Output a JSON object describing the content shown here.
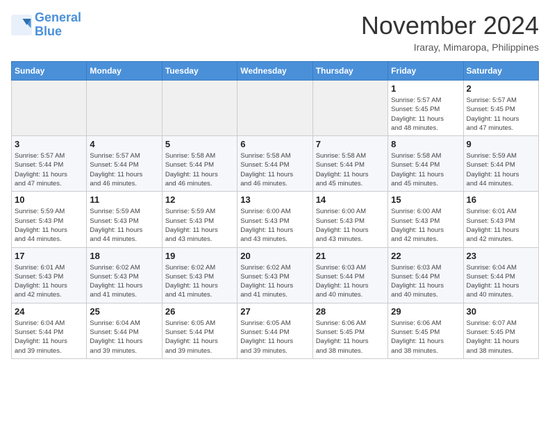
{
  "header": {
    "logo_line1": "General",
    "logo_line2": "Blue",
    "month_title": "November 2024",
    "location": "Iraray, Mimaropa, Philippines"
  },
  "days_of_week": [
    "Sunday",
    "Monday",
    "Tuesday",
    "Wednesday",
    "Thursday",
    "Friday",
    "Saturday"
  ],
  "weeks": [
    [
      {
        "day": "",
        "info": ""
      },
      {
        "day": "",
        "info": ""
      },
      {
        "day": "",
        "info": ""
      },
      {
        "day": "",
        "info": ""
      },
      {
        "day": "",
        "info": ""
      },
      {
        "day": "1",
        "info": "Sunrise: 5:57 AM\nSunset: 5:45 PM\nDaylight: 11 hours\nand 48 minutes."
      },
      {
        "day": "2",
        "info": "Sunrise: 5:57 AM\nSunset: 5:45 PM\nDaylight: 11 hours\nand 47 minutes."
      }
    ],
    [
      {
        "day": "3",
        "info": "Sunrise: 5:57 AM\nSunset: 5:44 PM\nDaylight: 11 hours\nand 47 minutes."
      },
      {
        "day": "4",
        "info": "Sunrise: 5:57 AM\nSunset: 5:44 PM\nDaylight: 11 hours\nand 46 minutes."
      },
      {
        "day": "5",
        "info": "Sunrise: 5:58 AM\nSunset: 5:44 PM\nDaylight: 11 hours\nand 46 minutes."
      },
      {
        "day": "6",
        "info": "Sunrise: 5:58 AM\nSunset: 5:44 PM\nDaylight: 11 hours\nand 46 minutes."
      },
      {
        "day": "7",
        "info": "Sunrise: 5:58 AM\nSunset: 5:44 PM\nDaylight: 11 hours\nand 45 minutes."
      },
      {
        "day": "8",
        "info": "Sunrise: 5:58 AM\nSunset: 5:44 PM\nDaylight: 11 hours\nand 45 minutes."
      },
      {
        "day": "9",
        "info": "Sunrise: 5:59 AM\nSunset: 5:44 PM\nDaylight: 11 hours\nand 44 minutes."
      }
    ],
    [
      {
        "day": "10",
        "info": "Sunrise: 5:59 AM\nSunset: 5:43 PM\nDaylight: 11 hours\nand 44 minutes."
      },
      {
        "day": "11",
        "info": "Sunrise: 5:59 AM\nSunset: 5:43 PM\nDaylight: 11 hours\nand 44 minutes."
      },
      {
        "day": "12",
        "info": "Sunrise: 5:59 AM\nSunset: 5:43 PM\nDaylight: 11 hours\nand 43 minutes."
      },
      {
        "day": "13",
        "info": "Sunrise: 6:00 AM\nSunset: 5:43 PM\nDaylight: 11 hours\nand 43 minutes."
      },
      {
        "day": "14",
        "info": "Sunrise: 6:00 AM\nSunset: 5:43 PM\nDaylight: 11 hours\nand 43 minutes."
      },
      {
        "day": "15",
        "info": "Sunrise: 6:00 AM\nSunset: 5:43 PM\nDaylight: 11 hours\nand 42 minutes."
      },
      {
        "day": "16",
        "info": "Sunrise: 6:01 AM\nSunset: 5:43 PM\nDaylight: 11 hours\nand 42 minutes."
      }
    ],
    [
      {
        "day": "17",
        "info": "Sunrise: 6:01 AM\nSunset: 5:43 PM\nDaylight: 11 hours\nand 42 minutes."
      },
      {
        "day": "18",
        "info": "Sunrise: 6:02 AM\nSunset: 5:43 PM\nDaylight: 11 hours\nand 41 minutes."
      },
      {
        "day": "19",
        "info": "Sunrise: 6:02 AM\nSunset: 5:43 PM\nDaylight: 11 hours\nand 41 minutes."
      },
      {
        "day": "20",
        "info": "Sunrise: 6:02 AM\nSunset: 5:43 PM\nDaylight: 11 hours\nand 41 minutes."
      },
      {
        "day": "21",
        "info": "Sunrise: 6:03 AM\nSunset: 5:44 PM\nDaylight: 11 hours\nand 40 minutes."
      },
      {
        "day": "22",
        "info": "Sunrise: 6:03 AM\nSunset: 5:44 PM\nDaylight: 11 hours\nand 40 minutes."
      },
      {
        "day": "23",
        "info": "Sunrise: 6:04 AM\nSunset: 5:44 PM\nDaylight: 11 hours\nand 40 minutes."
      }
    ],
    [
      {
        "day": "24",
        "info": "Sunrise: 6:04 AM\nSunset: 5:44 PM\nDaylight: 11 hours\nand 39 minutes."
      },
      {
        "day": "25",
        "info": "Sunrise: 6:04 AM\nSunset: 5:44 PM\nDaylight: 11 hours\nand 39 minutes."
      },
      {
        "day": "26",
        "info": "Sunrise: 6:05 AM\nSunset: 5:44 PM\nDaylight: 11 hours\nand 39 minutes."
      },
      {
        "day": "27",
        "info": "Sunrise: 6:05 AM\nSunset: 5:44 PM\nDaylight: 11 hours\nand 39 minutes."
      },
      {
        "day": "28",
        "info": "Sunrise: 6:06 AM\nSunset: 5:45 PM\nDaylight: 11 hours\nand 38 minutes."
      },
      {
        "day": "29",
        "info": "Sunrise: 6:06 AM\nSunset: 5:45 PM\nDaylight: 11 hours\nand 38 minutes."
      },
      {
        "day": "30",
        "info": "Sunrise: 6:07 AM\nSunset: 5:45 PM\nDaylight: 11 hours\nand 38 minutes."
      }
    ]
  ]
}
